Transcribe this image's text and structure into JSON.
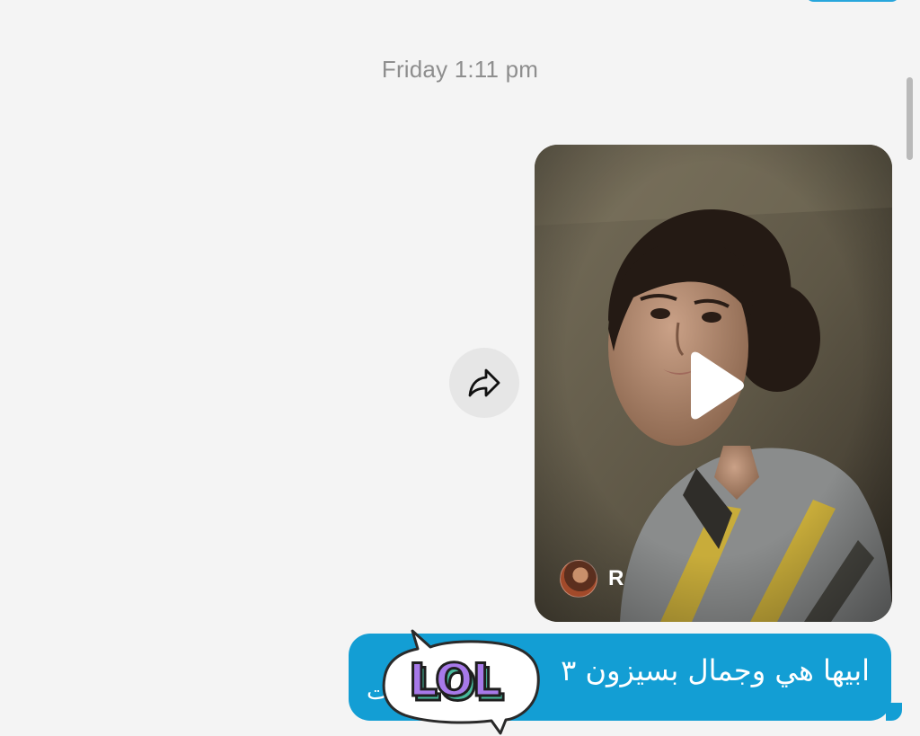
{
  "conversation": {
    "timestamp": "Friday 1:11 pm"
  },
  "shared_video": {
    "author_initial": "R",
    "icons": {
      "play": "play-icon",
      "share": "share-arrow-icon"
    }
  },
  "message": {
    "text": "ابيها هي وجمال بسيزون ٣",
    "overflow_text": "ت"
  },
  "reaction_sticker": {
    "text": "LOL",
    "icon": "lol-speech-bubble-sticker"
  },
  "colors": {
    "background": "#f4f4f4",
    "bubble": "#139ed4",
    "timestamp_text": "#8e8e8e",
    "sticker_fill": "#a779e9",
    "sticker_shadow": "#48b99d"
  }
}
